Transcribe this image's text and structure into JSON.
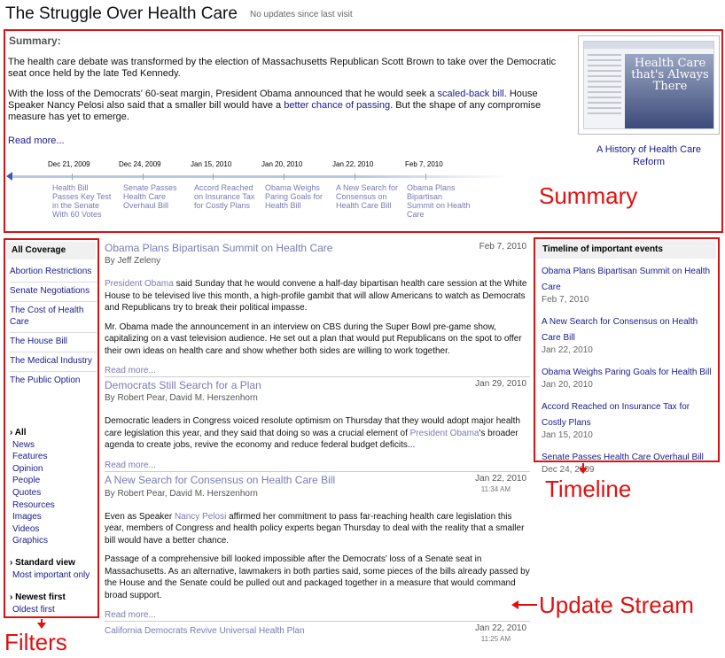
{
  "header": {
    "title": "The Struggle Over Health Care",
    "status": "No updates since last visit"
  },
  "summary": {
    "heading": "Summary:",
    "para1": "The health care debate was transformed by the election of Massachusetts Republican Scott Brown to take over the Democratic seat once held by the late Ted Kennedy.",
    "para2_a": "With the loss of the Democrats' 60-seat margin, President Obama announced that he would seek a ",
    "para2_link1": "scaled-back bill",
    "para2_b": ". House Speaker Nancy Pelosi also said that a smaller bill would have a ",
    "para2_link2": "better chance of passing",
    "para2_c": ". But the shape of any compromise measure has yet to emerge.",
    "read_more": "Read more...",
    "thumb_text": "Health Care that's Always There",
    "thumb_caption": "A History of Health Care Reform",
    "timeline": [
      {
        "date": "Dec 21, 2009",
        "label": "Health Bill Passes Key Test in the Senate With 60 Votes"
      },
      {
        "date": "Dec 24, 2009",
        "label": "Senate Passes Health Care Overhaul Bill"
      },
      {
        "date": "Jan 15, 2010",
        "label": "Accord Reached on Insurance Tax for Costly Plans"
      },
      {
        "date": "Jan 20, 2010",
        "label": "Obama Weighs Paring Goals for Health Bill"
      },
      {
        "date": "Jan 22, 2010",
        "label": "A New Search for Consensus on Health Care Bill"
      },
      {
        "date": "Feb 7, 2010",
        "label": "Obama Plans Bipartisan Summit on Health Care"
      }
    ]
  },
  "labels": {
    "summary": "Summary",
    "timeline": "Timeline",
    "stream": "Update Stream",
    "filters": "Filters"
  },
  "filters": {
    "heading": "All Coverage",
    "topics": [
      "Abortion Restrictions",
      "Senate Negotiations",
      "The Cost of Health Care",
      "The House Bill",
      "The Medical Industry",
      "The Public Option"
    ],
    "types_head": "› All",
    "types": [
      "News",
      "Features",
      "Opinion",
      "People",
      "Quotes",
      "Resources",
      "Images",
      "Videos",
      "Graphics"
    ],
    "view_head": "› Standard view",
    "view_alt": "Most important only",
    "order_head": "› Newest first",
    "order_alt": "Oldest first"
  },
  "stream": {
    "read_more": "Read more...",
    "articles": [
      {
        "title": "Obama Plans Bipartisan Summit on Health Care",
        "date": "Feb 7, 2010",
        "time": "",
        "byline": "By Jeff Zeleny",
        "p1_link": "President Obama",
        "p1_rest": " said Sunday that he would convene a half-day bipartisan health care session at the White House to be televised live this month, a high-profile gambit that will allow Americans to watch as Democrats and Republicans try to break their political impasse.",
        "p2": "Mr. Obama made the announcement in an interview on CBS during the Super Bowl pre-game show, capitalizing on a vast television audience. He set out a plan that would put Republicans on the spot to offer their own ideas on health care and show whether both sides are willing to work together."
      },
      {
        "title": "Democrats Still Search for a Plan",
        "date": "Jan 29, 2010",
        "time": "",
        "byline": "By Robert Pear, David M. Herszenhorn",
        "p1_a": "Democratic leaders in Congress voiced resolute optimism on Thursday that they would adopt major health care legislation this year, and they said that doing so was a crucial element of ",
        "p1_link": "President Obama",
        "p1_b": "'s broader agenda to create jobs, revive the economy and reduce federal budget deficits..."
      },
      {
        "title": "A New Search for Consensus on Health Care Bill",
        "date": "Jan 22, 2010",
        "time": "11:34 AM",
        "byline": "By Robert Pear, David M. Herszenhorn",
        "p1_a": "Even as Speaker ",
        "p1_link": "Nancy Pelosi",
        "p1_b": " affirmed her commitment to pass far-reaching health care legislation this year, members of Congress and health policy experts began Thursday to deal with the reality that a smaller bill would have a better chance.",
        "p2": "Passage of a comprehensive bill looked impossible after the Democrats' loss of a Senate seat in Massachusetts. As an alternative, lawmakers in both parties said, some pieces of the bills already passed by the House and the Senate could be pulled out and packaged together in a measure that would command broad support."
      },
      {
        "title": "California Democrats Revive Universal Health Plan",
        "date": "Jan 22, 2010",
        "time": "11:25 AM"
      }
    ]
  },
  "timeline_box": {
    "heading": "Timeline of important events",
    "events": [
      {
        "title": "Obama Plans Bipartisan Summit on Health Care",
        "date": "Feb 7, 2010"
      },
      {
        "title": "A New Search for Consensus on Health Care Bill",
        "date": "Jan 22, 2010"
      },
      {
        "title": "Obama Weighs Paring Goals for Health Bill",
        "date": "Jan 20, 2010"
      },
      {
        "title": "Accord Reached on Insurance Tax for Costly Plans",
        "date": "Jan 15, 2010"
      },
      {
        "title": "Senate Passes Health Care Overhaul Bill",
        "date": "Dec 24, 2009"
      }
    ]
  },
  "colors": {
    "annotation": "#e01010",
    "link": "#1a1a8c",
    "muted_link": "#7a7ab4"
  }
}
